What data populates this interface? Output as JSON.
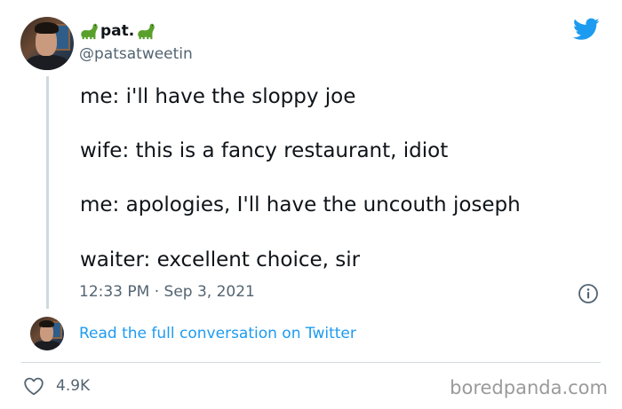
{
  "author": {
    "display_name": "pat.",
    "handle": "@patsatweetin",
    "name_emoji": "sauropod-dinosaur-icon"
  },
  "tweet": {
    "lines": [
      "me: i'll have the sloppy joe",
      "wife: this is a fancy restaurant, idiot",
      "me: apologies, I'll have the uncouth joseph",
      "waiter: excellent choice, sir"
    ],
    "timestamp": "12:33 PM · Sep 3, 2021"
  },
  "conversation_link": "Read the full conversation on Twitter",
  "engagement": {
    "likes": "4.9K"
  },
  "watermark": "boredpanda.com",
  "colors": {
    "link": "#1d9bf0",
    "twitter_blue": "#1d9bf0",
    "muted_text": "#536471",
    "dino_green": "#5aa02c"
  }
}
